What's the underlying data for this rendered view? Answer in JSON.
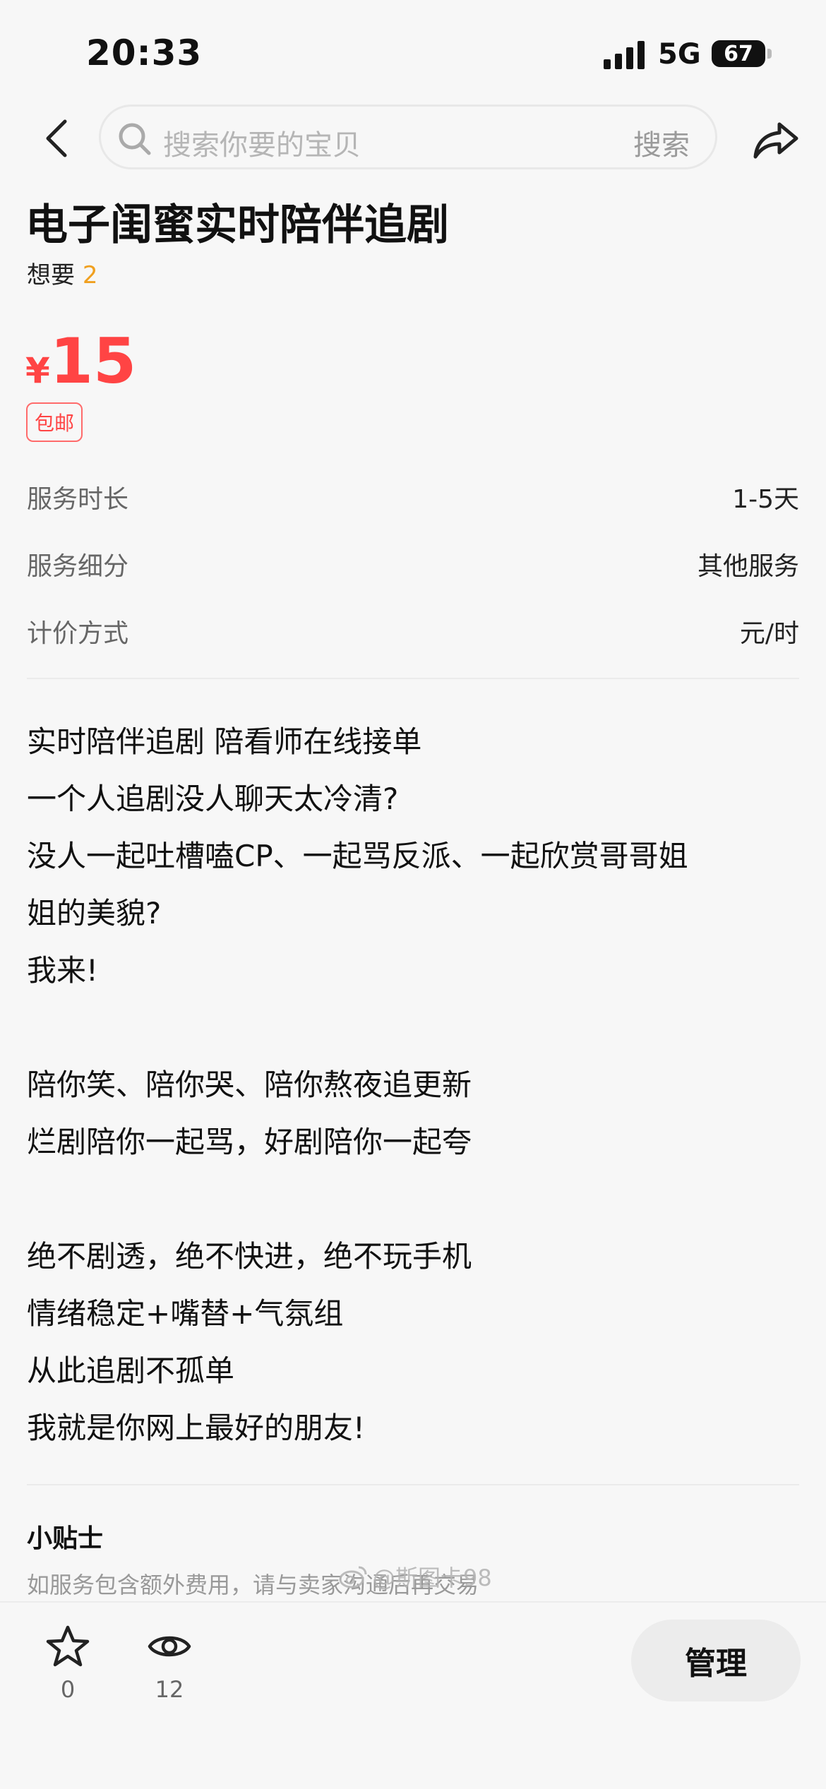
{
  "status_bar": {
    "time": "20:33",
    "network": "5G",
    "battery": "67"
  },
  "navbar": {
    "search_placeholder": "搜索你要的宝贝",
    "search_button": "搜索"
  },
  "product": {
    "title": "电子闺蜜实时陪伴追剧",
    "want_label": "想要",
    "want_count": "2",
    "price_symbol": "¥",
    "price": "15",
    "shipping_tag": "包邮"
  },
  "specs": [
    {
      "label": "服务时长",
      "value": "1-5天"
    },
    {
      "label": "服务细分",
      "value": "其他服务"
    },
    {
      "label": "计价方式",
      "value": "元/时"
    }
  ],
  "description": [
    "实时陪伴追剧 陪看师在线接单",
    "一个人追剧没人聊天太冷清?",
    "没人一起吐槽嗑CP、一起骂反派、一起欣赏哥哥姐",
    "姐的美貌?",
    "我来!",
    "",
    "陪你笑、陪你哭、陪你熬夜追更新",
    "烂剧陪你一起骂，好剧陪你一起夸",
    "",
    "绝不剧透，绝不快进，绝不玩手机",
    "情绪稳定+嘴替+气氛组",
    "从此追剧不孤单",
    "我就是你网上最好的朋友!"
  ],
  "tips": {
    "title": "小贴士",
    "text": "如服务包含额外费用，请与卖家沟通后再交易"
  },
  "bottom_bar": {
    "favorite_count": "0",
    "view_count": "12",
    "manage_label": "管理"
  },
  "watermark": "@斯图卡98"
}
